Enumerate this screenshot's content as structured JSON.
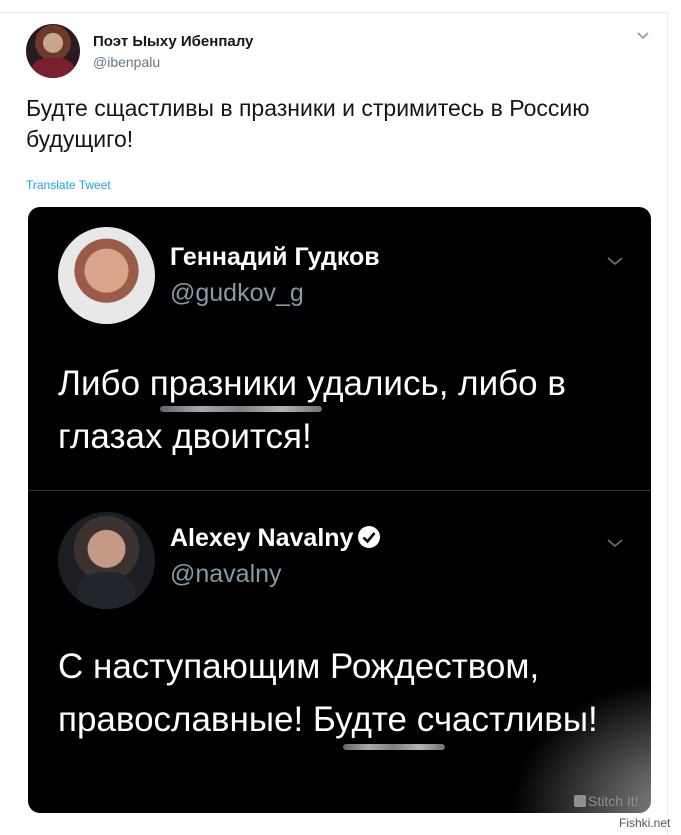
{
  "tweet": {
    "author_name": "Поэт Ыыху Ибенпалу",
    "author_handle": "@ibenpalu",
    "text": "Будте сщастливы в празники и стримитесь в Россию будущиго!",
    "translate_label": "Translate Tweet"
  },
  "quoted": {
    "first": {
      "name": "Геннадий Гудков",
      "handle": "@gudkov_g",
      "text": "Либо празники удались, либо в глазах двоится!"
    },
    "second": {
      "name": "Alexey Navalny",
      "handle": "@navalny",
      "text": "С наступающим Рождеством, православные! Будте счастливы!"
    }
  },
  "app_badge": "Stitch It!",
  "watermark": "Fishki.net",
  "colors": {
    "link": "#1da1f2",
    "dark_bg": "#000000",
    "handle_gray": "#8899a6"
  }
}
